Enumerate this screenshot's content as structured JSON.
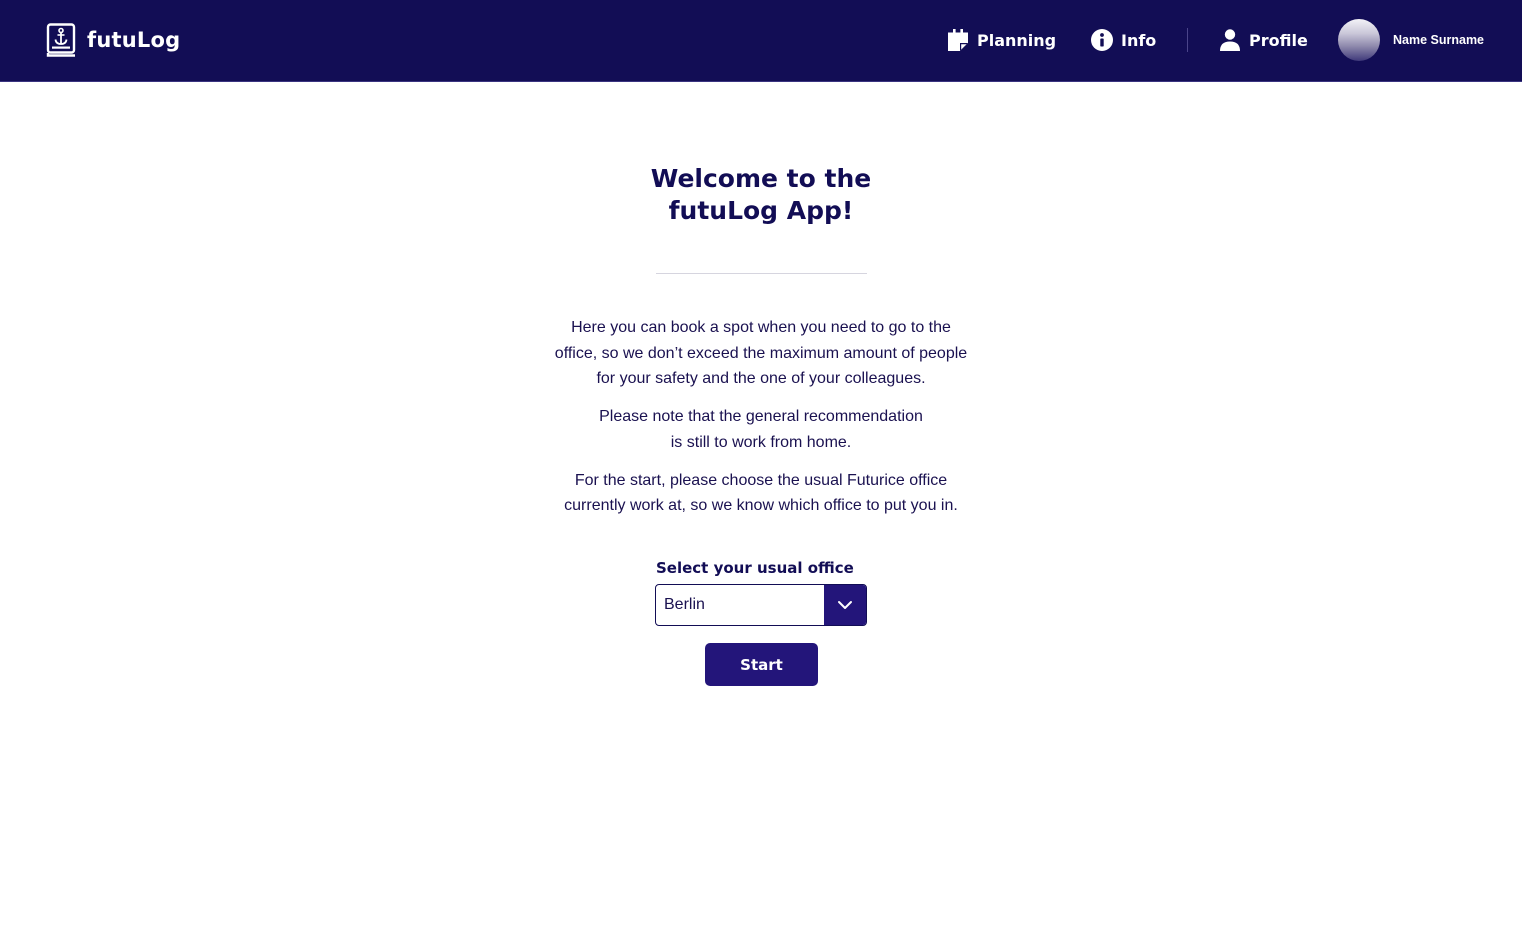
{
  "app": {
    "name": "futuLog"
  },
  "nav": {
    "planning_label": "Planning",
    "info_label": "Info",
    "profile_label": "Profile"
  },
  "user": {
    "name": "Name Surname"
  },
  "welcome": {
    "title_line1": "Welcome to the",
    "title_line2": "futuLog App!"
  },
  "intro": {
    "p1_line1": "Here you can book a spot when you need to go to the",
    "p1_line2": "office, so we don’t exceed the maximum amount of people",
    "p1_line3": "for your safety and the one of your colleagues.",
    "p2_line1": "Please note that the general recommendation",
    "p2_line2": "is still to work from home.",
    "p3_line1": "For the start, please choose the usual Futurice office",
    "p3_line2": "currently work at, so we know which office to put you in."
  },
  "office_select": {
    "label": "Select your usual office",
    "value": "Berlin"
  },
  "start_label": "Start",
  "colors": {
    "header_bg": "#120d55",
    "accent": "#23157a",
    "text": "#1a1150",
    "divider": "#d6d5df"
  },
  "icons": {
    "logo": "anchor-book-icon",
    "planning": "calendar-icon",
    "info": "info-icon",
    "profile": "person-icon",
    "select_toggle": "chevron-down-icon"
  }
}
